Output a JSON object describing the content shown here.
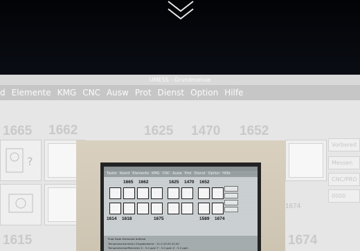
{
  "top": {
    "chevron_icon": "double-chevron-down-icon"
  },
  "background_app": {
    "title": "UMESS - Grundmenue",
    "menu": [
      "d",
      "Elemente",
      "KMG",
      "CNC",
      "Ausw",
      "Prot",
      "Dienst",
      "Option",
      "Hilfe"
    ],
    "numbers_row1": [
      "1665",
      "1662",
      "1625",
      "1470",
      "1652"
    ],
    "numbers_row3": [
      "1615",
      "1674"
    ],
    "number_mid": "1674",
    "side_fields": [
      "Vorbereit",
      "Messen",
      "CNC/PRO",
      "0000"
    ]
  },
  "monitor_screen": {
    "menu": [
      "Taster",
      "Koord",
      "Elemente",
      "KMG",
      "CNC",
      "Ausw",
      "Prot",
      "Dienst",
      "Option",
      "Hilfe"
    ],
    "numbers_top": [
      "1665",
      "1662",
      "1625",
      "1470",
      "1652"
    ],
    "numbers_bottom": [
      "1614",
      "1618",
      "1675",
      "1589",
      "1674"
    ],
    "status_lines": [
      "Prob Taste Elemente defined",
      "Temperaturkorrektur Eingabewerte  :   21.0      20.00     20.00",
      "Temperaturkoeffizienten  X :    5.0 ppm  Y :     5.0 ppm  Z :      5.0 ppm"
    ]
  },
  "colors": {
    "background_gray": "#e6e6e6",
    "monitor_beige": "#d4cbbb",
    "crt_screen": "#cfd4d6"
  }
}
